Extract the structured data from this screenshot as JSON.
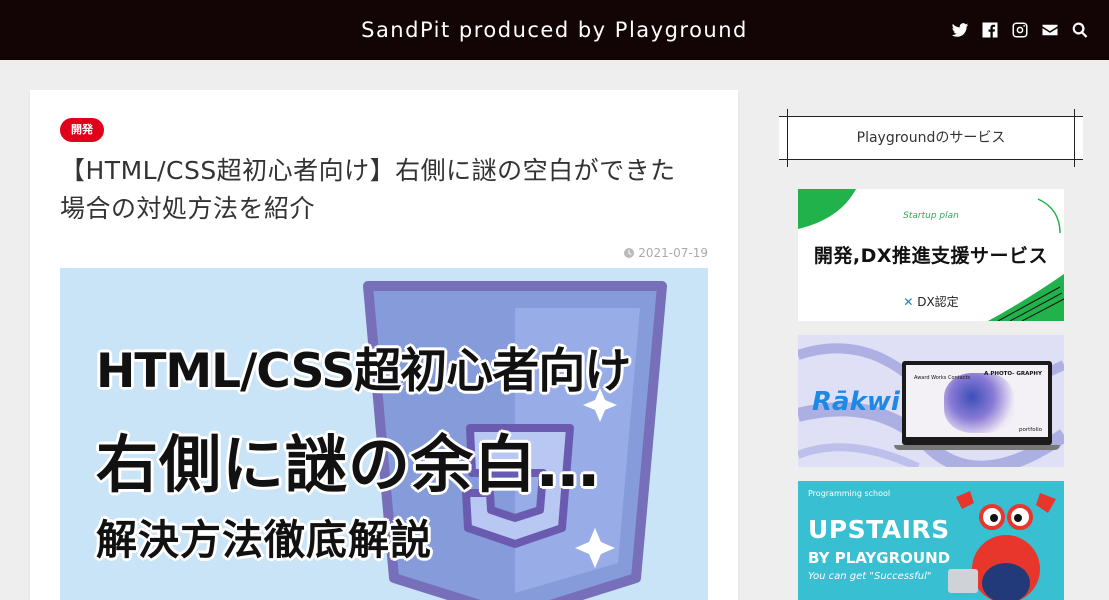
{
  "header": {
    "site_title": "SandPit produced by Playground",
    "icons": [
      "twitter-icon",
      "facebook-icon",
      "instagram-icon",
      "mail-icon",
      "search-icon"
    ]
  },
  "article": {
    "category": "開発",
    "title": "【HTML/CSS超初心者向け】右側に謎の空白ができた場合の対処方法を紹介",
    "date": "2021-07-19",
    "eyecatch": {
      "line1": "HTML/CSS超初心者向け",
      "line2": "右側に謎の余白…",
      "line3": "解決方法徹底解説"
    }
  },
  "sidebar": {
    "widget_title": "Playgroundのサービス",
    "banner1": {
      "small": "Startup plan",
      "main": "開発,DX推進支援サービス",
      "badge": "DX認定"
    },
    "banner2": {
      "logo": "Rākwi",
      "screen_title": "A PHOTO- GRAPHY",
      "screen_menu": "Award Works Contacts",
      "screen_footer": "portfolio"
    },
    "banner3": {
      "small": "Programming school",
      "title": "UPSTAIRS",
      "subtitle": "BY PLAYGROUND",
      "tagline": "You can get \"Successful\""
    }
  },
  "colors": {
    "header_bg": "#130505",
    "badge_red": "#e1001a",
    "eyecatch_bg": "#c8e4f6",
    "upstairs_bg": "#38bfd2"
  }
}
